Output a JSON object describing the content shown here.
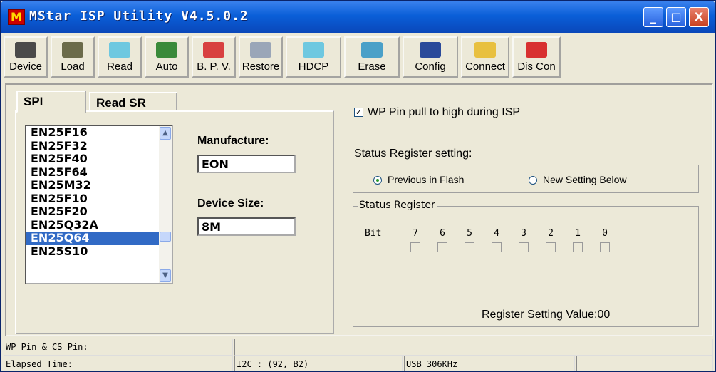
{
  "window": {
    "icon_letter": "M",
    "title": "MStar ISP Utility V4.5.0.2",
    "minimize": "_",
    "maximize": "□",
    "close": "X"
  },
  "toolbar": [
    {
      "id": "device",
      "label": "Device",
      "color": "#4a4a4a"
    },
    {
      "id": "load",
      "label": "Load",
      "color": "#6b6b4a"
    },
    {
      "id": "read",
      "label": "Read",
      "color": "#6ec8e0"
    },
    {
      "id": "auto",
      "label": "Auto",
      "color": "#3a8a3a"
    },
    {
      "id": "bpv",
      "label": "B. P. V.",
      "color": "#d84040"
    },
    {
      "id": "restore",
      "label": "Restore",
      "color": "#9aa6b8"
    },
    {
      "id": "hdcp",
      "label": "HDCP",
      "color": "#6ec8e0"
    },
    {
      "id": "erase",
      "label": "Erase",
      "color": "#4aa0c8"
    },
    {
      "id": "config",
      "label": "Config",
      "color": "#2a4a9a"
    },
    {
      "id": "connect",
      "label": "Connect",
      "color": "#e8c040"
    },
    {
      "id": "discon",
      "label": "Dis Con",
      "color": "#d83030"
    }
  ],
  "tabs": [
    "SPI",
    "Read SR"
  ],
  "chip_list": {
    "items": [
      "EN25F16",
      "EN25F32",
      "EN25F40",
      "EN25F64",
      "EN25M32",
      "EN25F10",
      "EN25F20",
      "EN25Q32A",
      "EN25Q64",
      "EN25S10"
    ],
    "selected": "EN25Q64"
  },
  "fields": {
    "manufacture_label": "Manufacture:",
    "manufacture_value": "EON",
    "device_size_label": "Device Size:",
    "device_size_value": "8M"
  },
  "wp_pin": {
    "label": "WP Pin pull to high during ISP",
    "checked": true,
    "mark": "✓"
  },
  "status_register": {
    "setting_label": "Status Register setting:",
    "radio_previous": "Previous in Flash",
    "radio_new": "New Setting Below",
    "selected": "Previous in Flash",
    "group_label": "Status Register",
    "bit_label": "Bit",
    "bits": [
      "7",
      "6",
      "5",
      "4",
      "3",
      "2",
      "1",
      "0"
    ],
    "value_label": "Register Setting Value:00"
  },
  "statusbar": {
    "wp_cs": "WP Pin & CS Pin:",
    "elapsed": "Elapsed Time:",
    "i2c": "I2C :  (92, B2)",
    "usb": "USB  306KHz"
  }
}
